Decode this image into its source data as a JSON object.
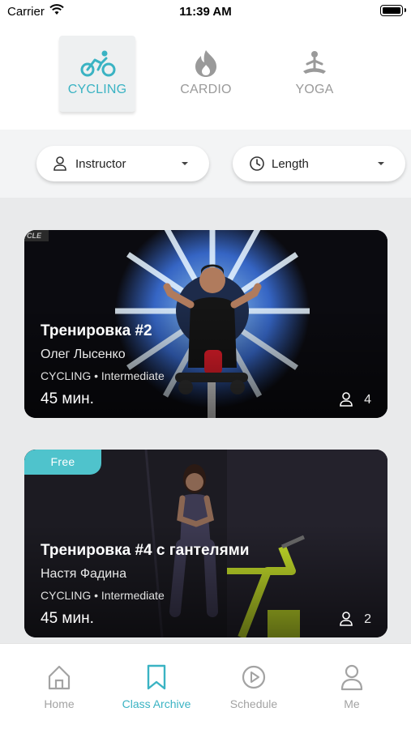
{
  "status_bar": {
    "carrier": "Carrier",
    "time": "11:39 AM",
    "wifi_icon": "wifi-icon",
    "battery_icon": "battery-icon"
  },
  "categories": [
    {
      "label": "CYCLING",
      "icon": "bicycle-icon",
      "active": true
    },
    {
      "label": "CARDIO",
      "icon": "flame-icon",
      "active": false
    },
    {
      "label": "YOGA",
      "icon": "meditation-icon",
      "active": false
    }
  ],
  "filters": {
    "instructor": {
      "label": "Instructor",
      "icon": "person-icon"
    },
    "length": {
      "label": "Length",
      "icon": "clock-icon"
    }
  },
  "classes": [
    {
      "title": "Тренировка #2",
      "instructor": "Олег Лысенко",
      "meta": "CYCLING • Intermediate",
      "duration": "45 мин.",
      "participants": "4",
      "badge": ""
    },
    {
      "title": "Тренировка #4 с гантелями",
      "instructor": "Настя Фадина",
      "meta": "CYCLING • Intermediate",
      "duration": "45 мин.",
      "participants": "2",
      "badge": "Free"
    }
  ],
  "tab_bar": [
    {
      "label": "Home",
      "icon": "home-icon",
      "active": false
    },
    {
      "label": "Class Archive",
      "icon": "bookmark-icon",
      "active": true
    },
    {
      "label": "Schedule",
      "icon": "play-circle-icon",
      "active": false
    },
    {
      "label": "Me",
      "icon": "profile-icon",
      "active": false
    }
  ],
  "colors": {
    "accent": "#3ab3c3",
    "free_badge": "#4fc3cc",
    "inactive": "#a3a3a3"
  }
}
